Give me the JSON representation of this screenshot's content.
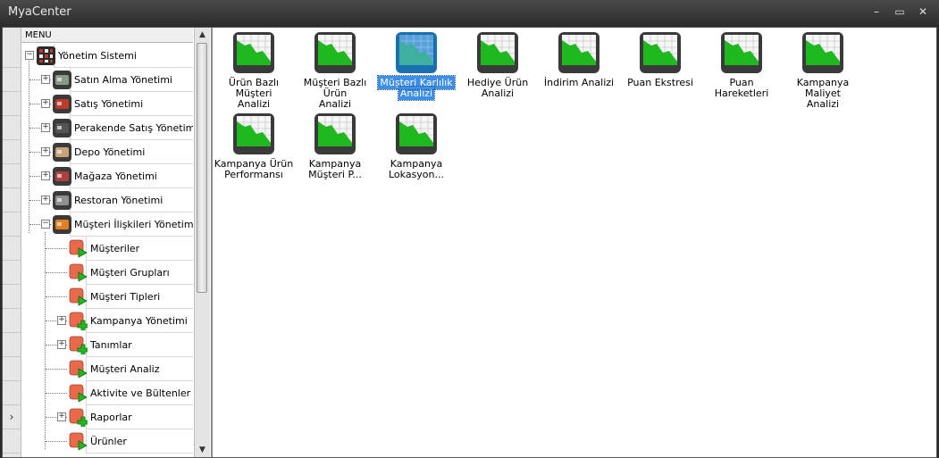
{
  "window": {
    "title": "MyaCenter",
    "minimize": "–",
    "maximize": "▭",
    "close": "✕"
  },
  "tree": {
    "header": "MENU",
    "nodes": [
      {
        "label": "Yönetim Sistemi",
        "level": 0,
        "expander": "−",
        "icon": "grid-icon",
        "color": "#c0392b"
      },
      {
        "label": "Satın Alma Yönetimi",
        "level": 1,
        "expander": "+",
        "icon": "cart-icon",
        "color": "#8a9a8a"
      },
      {
        "label": "Satış Yönetimi",
        "level": 1,
        "expander": "+",
        "icon": "truck-icon",
        "color": "#c0392b"
      },
      {
        "label": "Perakende Satış Yönetimi",
        "level": 1,
        "expander": "+",
        "icon": "barcode-icon",
        "color": "#555555"
      },
      {
        "label": "Depo Yönetimi",
        "level": 1,
        "expander": "+",
        "icon": "boxes-icon",
        "color": "#c9a27a"
      },
      {
        "label": "Mağaza Yönetimi",
        "level": 1,
        "expander": "+",
        "icon": "store-icon",
        "color": "#b04040"
      },
      {
        "label": "Restoran Yönetimi",
        "level": 1,
        "expander": "+",
        "icon": "restaurant-icon",
        "color": "#909090"
      },
      {
        "label": "Müşteri İlişkileri Yönetimi",
        "level": 1,
        "expander": "−",
        "icon": "crm-icon",
        "color": "#e67e22"
      },
      {
        "label": "Müşteriler",
        "level": 2,
        "expander": "",
        "icon": "play-doc-icon",
        "color": "#e86a4a"
      },
      {
        "label": "Müşteri Grupları",
        "level": 2,
        "expander": "",
        "icon": "play-doc-icon",
        "color": "#e86a4a"
      },
      {
        "label": "Müşteri Tipleri",
        "level": 2,
        "expander": "",
        "icon": "play-doc-icon",
        "color": "#e86a4a"
      },
      {
        "label": "Kampanya Yönetimi",
        "level": 2,
        "expander": "+",
        "icon": "plus-doc-icon",
        "color": "#e86a4a"
      },
      {
        "label": "Tanımlar",
        "level": 2,
        "expander": "+",
        "icon": "plus-doc-icon",
        "color": "#e86a4a"
      },
      {
        "label": "Müşteri Analiz",
        "level": 2,
        "expander": "",
        "icon": "play-doc-icon",
        "color": "#e86a4a"
      },
      {
        "label": "Aktivite ve Bültenler",
        "level": 2,
        "expander": "",
        "icon": "play-doc-icon",
        "color": "#e86a4a"
      },
      {
        "label": "Raporlar",
        "level": 2,
        "expander": "+",
        "icon": "plus-doc-icon",
        "color": "#e86a4a"
      },
      {
        "label": "Ürünler",
        "level": 2,
        "expander": "",
        "icon": "play-doc-icon",
        "color": "#e86a4a"
      }
    ],
    "current_row_marker": "›",
    "current_row_index": 15
  },
  "scroll": {
    "up": "▲",
    "down": "▼"
  },
  "tiles": [
    {
      "line1": "Ürün Bazlı Müşteri",
      "line2": "Analizi",
      "selected": false
    },
    {
      "line1": "Müşteri Bazlı Ürün",
      "line2": "Analizi",
      "selected": false
    },
    {
      "line1": "Müşteri Karlılık",
      "line2": "Analizi",
      "selected": true
    },
    {
      "line1": "Hediye Ürün",
      "line2": "Analizi",
      "selected": false
    },
    {
      "line1": "İndirim Analizi",
      "line2": "",
      "selected": false
    },
    {
      "line1": "Puan Ekstresi",
      "line2": "",
      "selected": false
    },
    {
      "line1": "Puan Hareketleri",
      "line2": "",
      "selected": false
    },
    {
      "line1": "Kampanya Maliyet",
      "line2": "Analizi",
      "selected": false
    },
    {
      "line1": "Kampanya Ürün",
      "line2": "Performansı",
      "selected": false
    },
    {
      "line1": "Kampanya",
      "line2": "Müşteri P...",
      "selected": false
    },
    {
      "line1": "Kampanya",
      "line2": "Lokasyon...",
      "selected": false
    }
  ],
  "colors": {
    "chart_green": "#1fb81f",
    "chart_frame": "#3a3a3a",
    "selection": "#3d8ee6"
  }
}
